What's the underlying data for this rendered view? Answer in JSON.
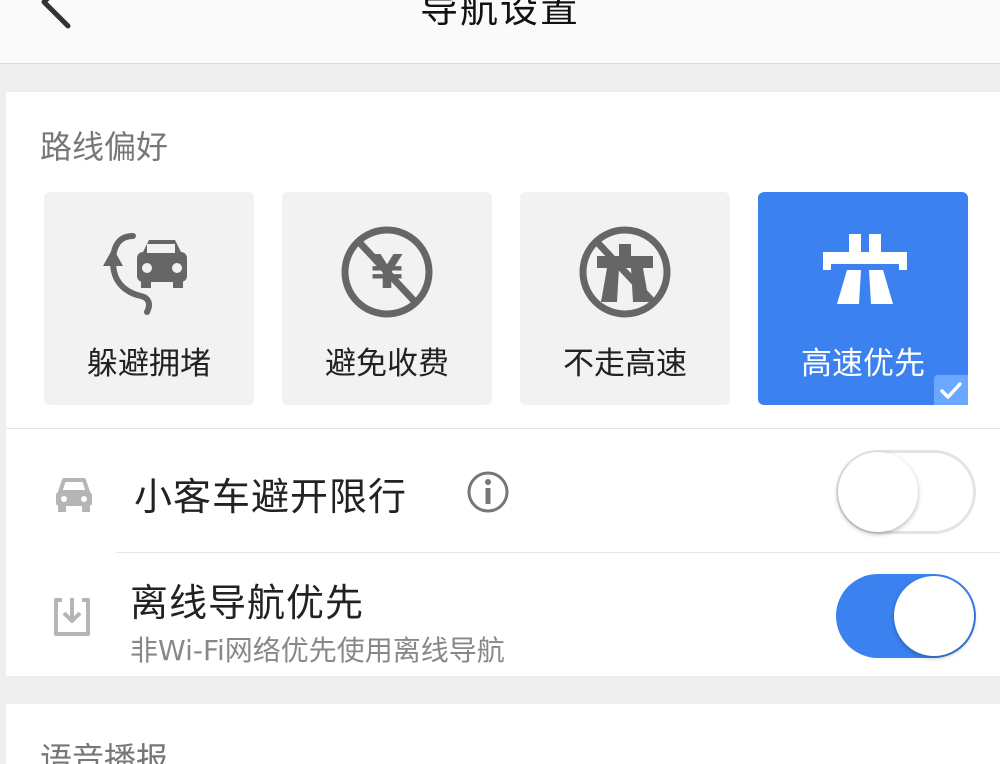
{
  "header": {
    "title": "导航设置",
    "back_icon": "chevron-left-icon"
  },
  "route_preference": {
    "title": "路线偏好",
    "options": [
      {
        "label": "躲避拥堵",
        "icon": "avoid-congestion-icon",
        "selected": false
      },
      {
        "label": "避免收费",
        "icon": "no-toll-icon",
        "selected": false
      },
      {
        "label": "不走高速",
        "icon": "no-highway-icon",
        "selected": false
      },
      {
        "label": "高速优先",
        "icon": "highway-icon",
        "selected": true
      }
    ]
  },
  "settings": {
    "car_restriction": {
      "label": "小客车避开限行",
      "icon": "car-icon",
      "info_icon": "info-icon",
      "enabled": false
    },
    "offline_nav": {
      "label": "离线导航优先",
      "sublabel": "非Wi-Fi网络优先使用离线导航",
      "icon": "download-icon",
      "enabled": true
    }
  },
  "voice": {
    "title": "语音播报"
  },
  "colors": {
    "accent": "#3b82f0",
    "icon_gray": "#666666",
    "background": "#efefef"
  }
}
